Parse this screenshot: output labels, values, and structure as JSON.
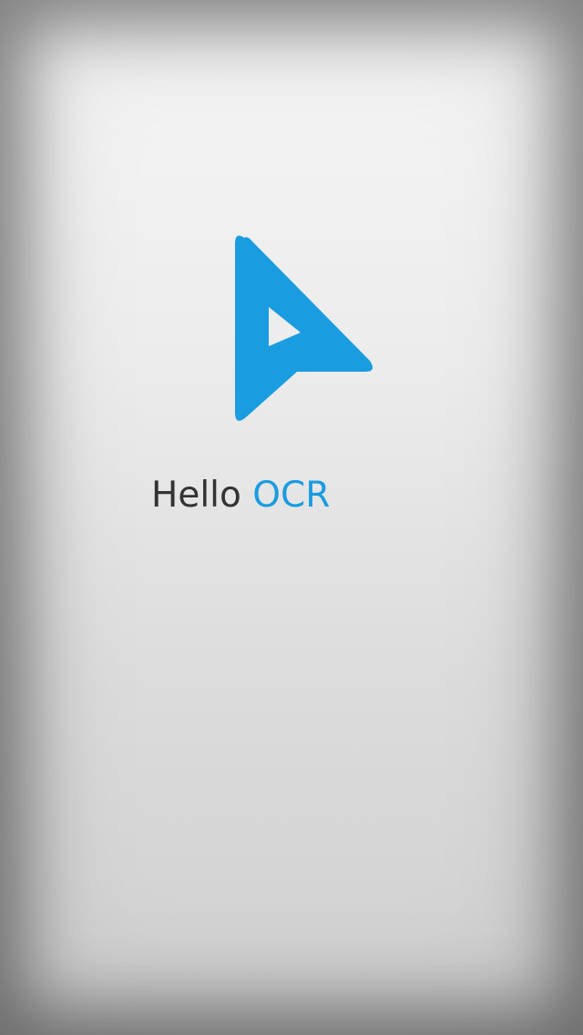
{
  "splash": {
    "logo_icon": "play-cursor-icon",
    "brand_color": "#1a9ce0",
    "text_color": "#333333",
    "title_word_1": "Hello",
    "title_word_2": "OCR"
  }
}
